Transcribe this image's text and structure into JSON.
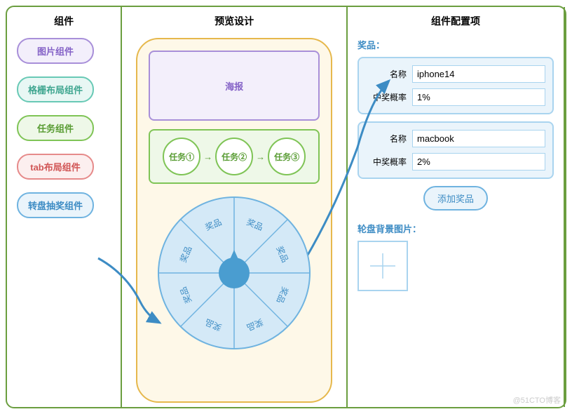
{
  "cols": {
    "c1": "组件",
    "c2": "预览设计",
    "c3": "组件配置项"
  },
  "components": [
    "图片组件",
    "格栅布局组件",
    "任务组件",
    "tab布局组件",
    "转盘抽奖组件"
  ],
  "poster": "海报",
  "tasks": [
    "任务①",
    "任务②",
    "任务③"
  ],
  "wheel_label": "奖品",
  "config": {
    "prizes_label": "奖品：",
    "name_label": "名称",
    "prob_label": "中奖概率",
    "prizes": [
      {
        "name": "iphone14",
        "prob": "1%"
      },
      {
        "name": "macbook",
        "prob": "2%"
      }
    ],
    "add": "添加奖品",
    "bg_label": "轮盘背景图片："
  },
  "watermark": "@51CTO博客"
}
